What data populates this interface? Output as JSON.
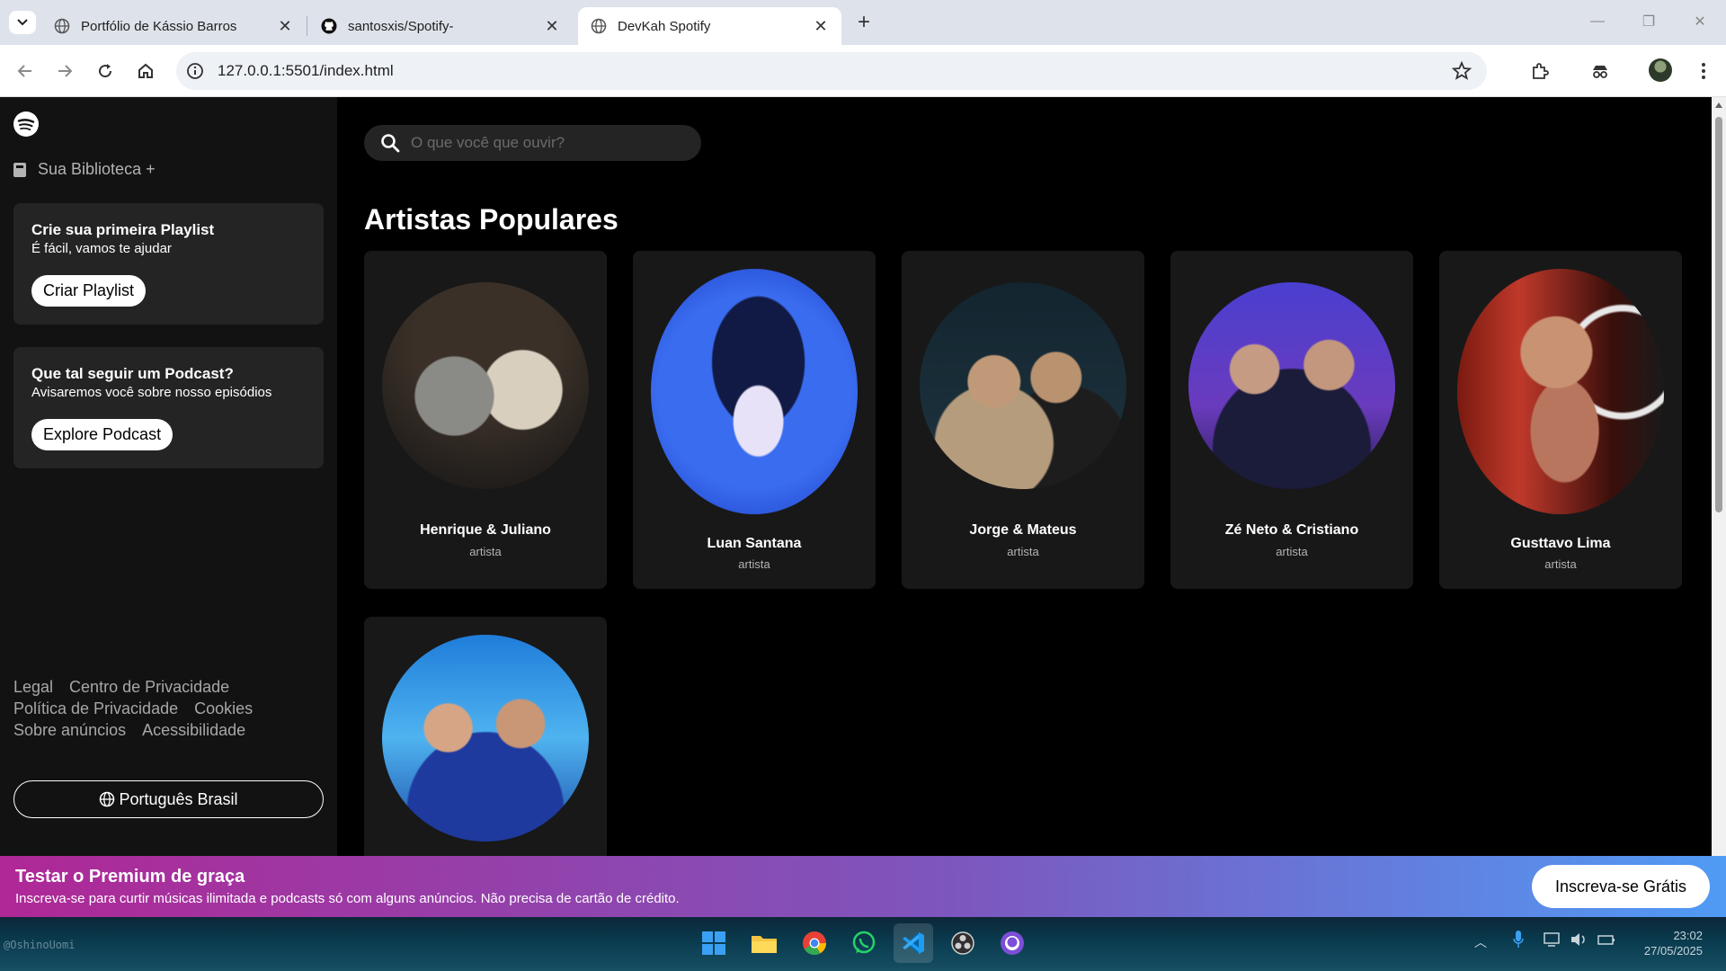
{
  "browser": {
    "tabs": [
      {
        "title": "Portfólio de Kássio Barros",
        "icon": "globe-icon",
        "active": false
      },
      {
        "title": "santosxis/Spotify-",
        "icon": "github-icon",
        "active": false
      },
      {
        "title": "DevKah Spotify",
        "icon": "globe-icon",
        "active": true
      }
    ],
    "url": "127.0.0.1:5501/index.html"
  },
  "sidebar": {
    "library_label": "Sua Biblioteca +",
    "playlist_card": {
      "title": "Crie sua primeira Playlist",
      "subtitle": "É fácil, vamos te ajudar",
      "button": "Criar Playlist"
    },
    "podcast_card": {
      "title": "Que tal seguir um Podcast?",
      "subtitle": "Avisaremos você sobre nosso episódios",
      "button": "Explore Podcast"
    },
    "footer_links": [
      "Legal",
      "Centro de Privacidade",
      "Política de Privacidade",
      "Cookies",
      "Sobre anúncios",
      "Acessibilidade"
    ],
    "language_button": "Português Brasil"
  },
  "main": {
    "search_placeholder": "O que você que ouvir?",
    "section_title": "Artistas Populares",
    "artists": [
      {
        "name": "Henrique & Juliano",
        "role": "artista"
      },
      {
        "name": "Luan Santana",
        "role": "artista"
      },
      {
        "name": "Jorge & Mateus",
        "role": "artista"
      },
      {
        "name": "Zé Neto & Cristiano",
        "role": "artista"
      },
      {
        "name": "Gusttavo Lima",
        "role": "artista"
      }
    ]
  },
  "promo": {
    "title": "Testar o Premium de graça",
    "text": "Inscreva-se para curtir músicas ilimitada e podcasts só com alguns anúncios. Não precisa de cartão de crédito.",
    "cta": "Inscreva-se Grátis"
  },
  "taskbar": {
    "clock_time": "23:02",
    "clock_date": "27/05/2025",
    "watermark": "@OshinoUomi"
  },
  "colors": {
    "spotify_bg": "#000000",
    "sidebar_bg": "#121212",
    "card_bg": "#181818",
    "panel_bg": "#242424",
    "promo_start": "#af2896",
    "promo_end": "#509bf5"
  }
}
